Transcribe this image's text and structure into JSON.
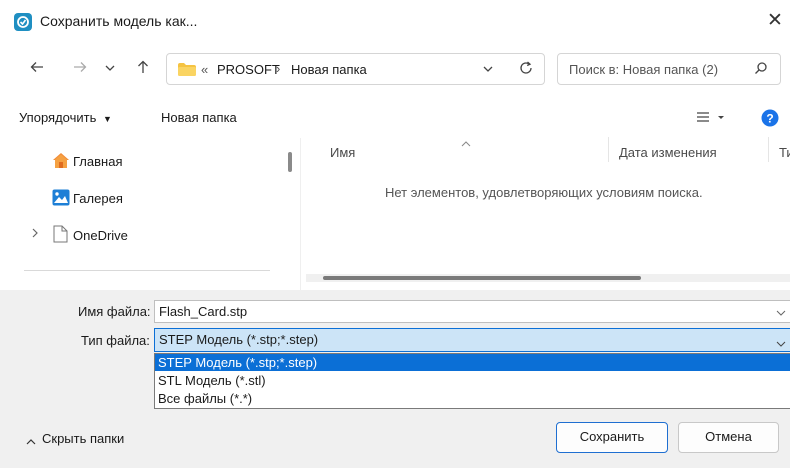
{
  "window": {
    "title": "Сохранить модель как...",
    "close_label": "✕"
  },
  "address": {
    "overflow": "«",
    "crumbs": [
      "PROSOFT",
      "Новая папка"
    ],
    "separator": "›",
    "search_placeholder": "Поиск в: Новая папка (2)"
  },
  "toolbar": {
    "organize_label": "Упорядочить",
    "new_folder_label": "Новая папка"
  },
  "nav": {
    "items": [
      {
        "label": "Главная"
      },
      {
        "label": "Галерея"
      },
      {
        "label": "OneDrive"
      }
    ]
  },
  "list": {
    "columns": [
      "Имя",
      "Дата изменения",
      "Ти"
    ],
    "empty_message": "Нет элементов, удовлетворяющих условиям поиска."
  },
  "form": {
    "filename_label": "Имя файла:",
    "filename_value": "Flash_Card.stp",
    "filetype_label": "Тип файла:",
    "filetype_value": "STEP Модель (*.stp;*.step)",
    "filetype_options": [
      "STEP Модель (*.stp;*.step)",
      "STL Модель (*.stl)",
      "Все файлы (*.*)"
    ]
  },
  "footer": {
    "hide_folders_label": "Скрыть папки",
    "save_label": "Сохранить",
    "cancel_label": "Отмена"
  },
  "colors": {
    "accent": "#1f6fd1",
    "selection": "#0b6fd6",
    "folder": "#f5c342",
    "help": "#1a73e8"
  }
}
